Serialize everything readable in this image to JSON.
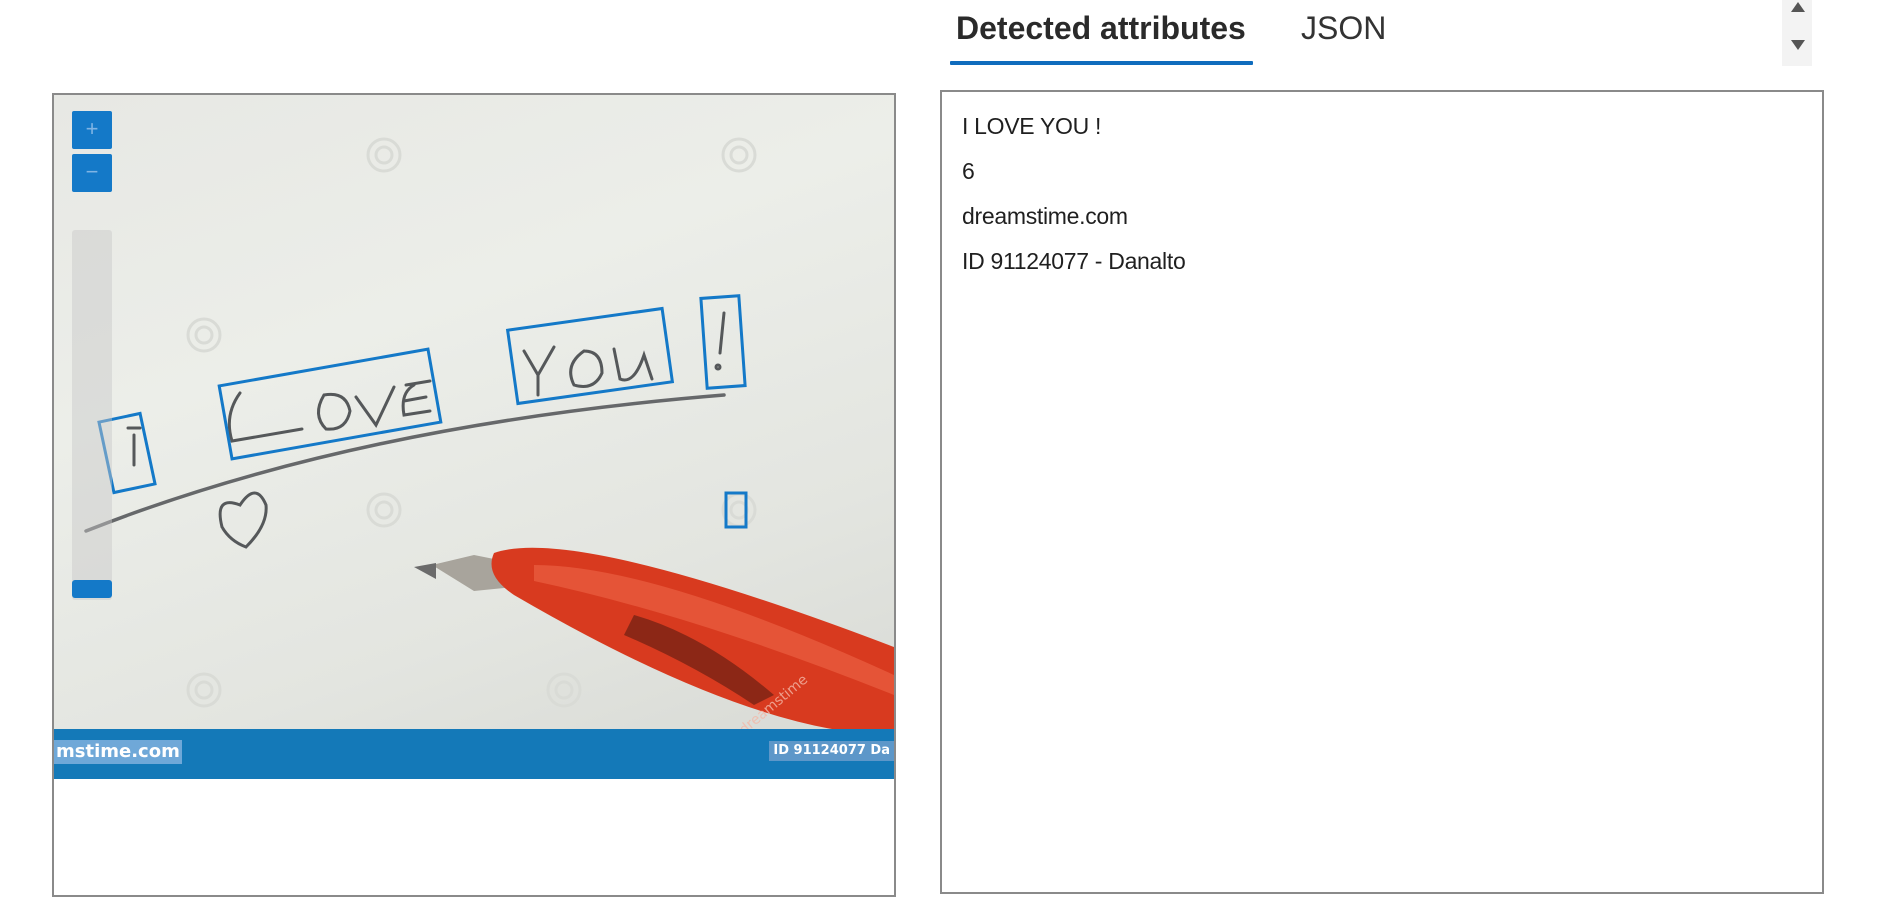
{
  "tabs": [
    {
      "label": "Detected attributes",
      "active": true
    },
    {
      "label": "JSON",
      "active": false
    }
  ],
  "viewer": {
    "zoom_in_label": "+",
    "zoom_out_label": "−",
    "zoom_level": 0.0,
    "handwriting_words": [
      "I",
      "LOVE",
      "YOU",
      "!"
    ],
    "watermark_left": "mstime.com",
    "watermark_right": "ID 91124077 Da",
    "pen_text": "dreamstime",
    "accent_color": "#1479c8"
  },
  "results": {
    "lines": [
      "I LOVE YOU !",
      "6",
      "dreamstime.com",
      "ID 91124077 - Danalto"
    ]
  }
}
